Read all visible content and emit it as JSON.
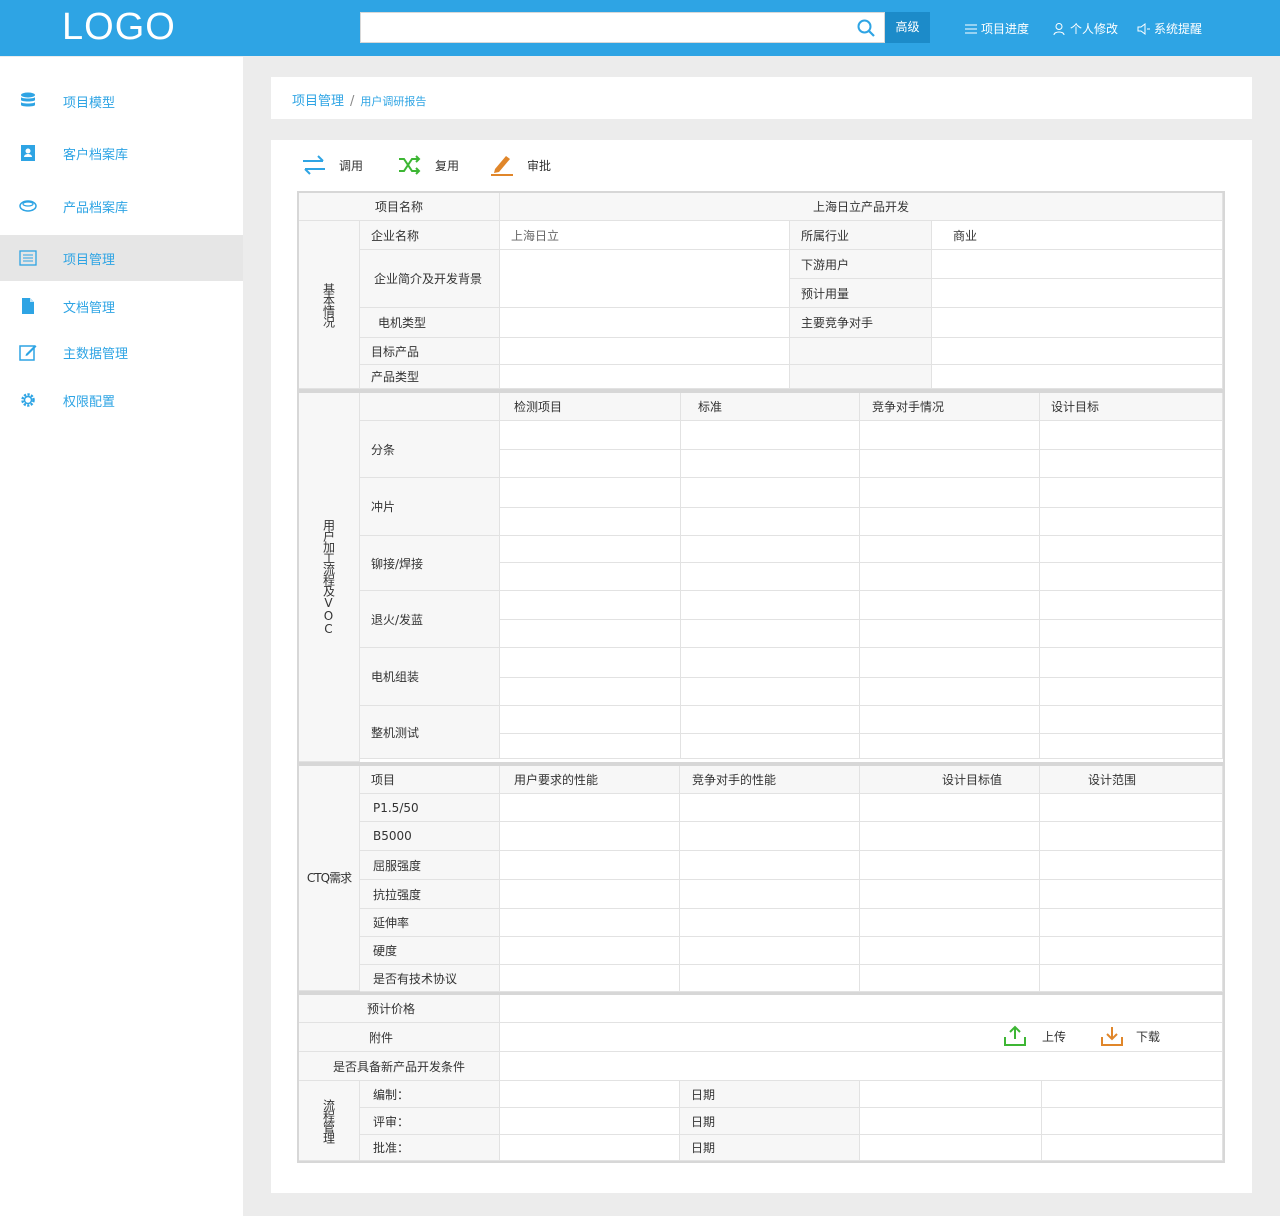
{
  "header": {
    "logo": "LOGO",
    "search": {
      "placeholder": "",
      "advanced_label": "高级"
    },
    "nav": [
      {
        "label": "项目进度",
        "icon": "list-icon"
      },
      {
        "label": "个人修改",
        "icon": "user-edit-icon"
      },
      {
        "label": "系统提醒",
        "icon": "speaker-icon"
      }
    ]
  },
  "sidebar": {
    "items": [
      {
        "label": "项目模型",
        "icon": "database-icon"
      },
      {
        "label": "客户档案库",
        "icon": "contacts-icon"
      },
      {
        "label": "产品档案库",
        "icon": "box-icon"
      },
      {
        "label": "项目管理",
        "icon": "list-lines-icon",
        "active": true
      },
      {
        "label": "文档管理",
        "icon": "document-icon"
      },
      {
        "label": "主数据管理",
        "icon": "edit-icon"
      },
      {
        "label": "权限配置",
        "icon": "gear-icon"
      }
    ]
  },
  "breadcrumb": {
    "root": "项目管理",
    "sep": "/",
    "current": "用户调研报告"
  },
  "toolbar": {
    "call": "调用",
    "reuse": "复用",
    "approve": "审批"
  },
  "basic": {
    "section": "基本情况",
    "project_name_label": "项目名称",
    "project_name_value": "上海日立产品开发",
    "company_name_label": "企业名称",
    "company_name_value": "上海日立",
    "industry_label": "所属行业",
    "industry_value": "商业",
    "intro_label": "企业简介及开发背景",
    "downstream_label": "下游用户",
    "usage_label": "预计用量",
    "motor_type_label": "电机类型",
    "competitor_label": "主要竞争对手",
    "target_product_label": "目标产品",
    "product_type_label": "产品类型"
  },
  "process": {
    "section": "用户加工流程及VOC",
    "headers": [
      "检测项目",
      "标准",
      "竞争对手情况",
      "设计目标"
    ],
    "rows": [
      "分条",
      "冲片",
      "铆接/焊接",
      "退火/发蓝",
      "电机组装",
      "整机测试"
    ]
  },
  "ctq": {
    "section": "CTQ需求",
    "headers": [
      "项目",
      "用户要求的性能",
      "竞争对手的性能",
      "设计目标值",
      "设计范围"
    ],
    "rows": [
      "P1.5/50",
      "B5000",
      "屈服强度",
      "抗拉强度",
      "延伸率",
      "硬度",
      "是否有技术协议"
    ]
  },
  "misc": {
    "price_label": "预计价格",
    "attachment_label": "附件",
    "upload_label": "上传",
    "download_label": "下载",
    "condition_label": "是否具备新产品开发条件"
  },
  "flow": {
    "section": "流程管理",
    "rows": [
      {
        "label": "编制：",
        "date_label": "日期"
      },
      {
        "label": "评审：",
        "date_label": "日期"
      },
      {
        "label": "批准：",
        "date_label": "日期"
      }
    ]
  }
}
